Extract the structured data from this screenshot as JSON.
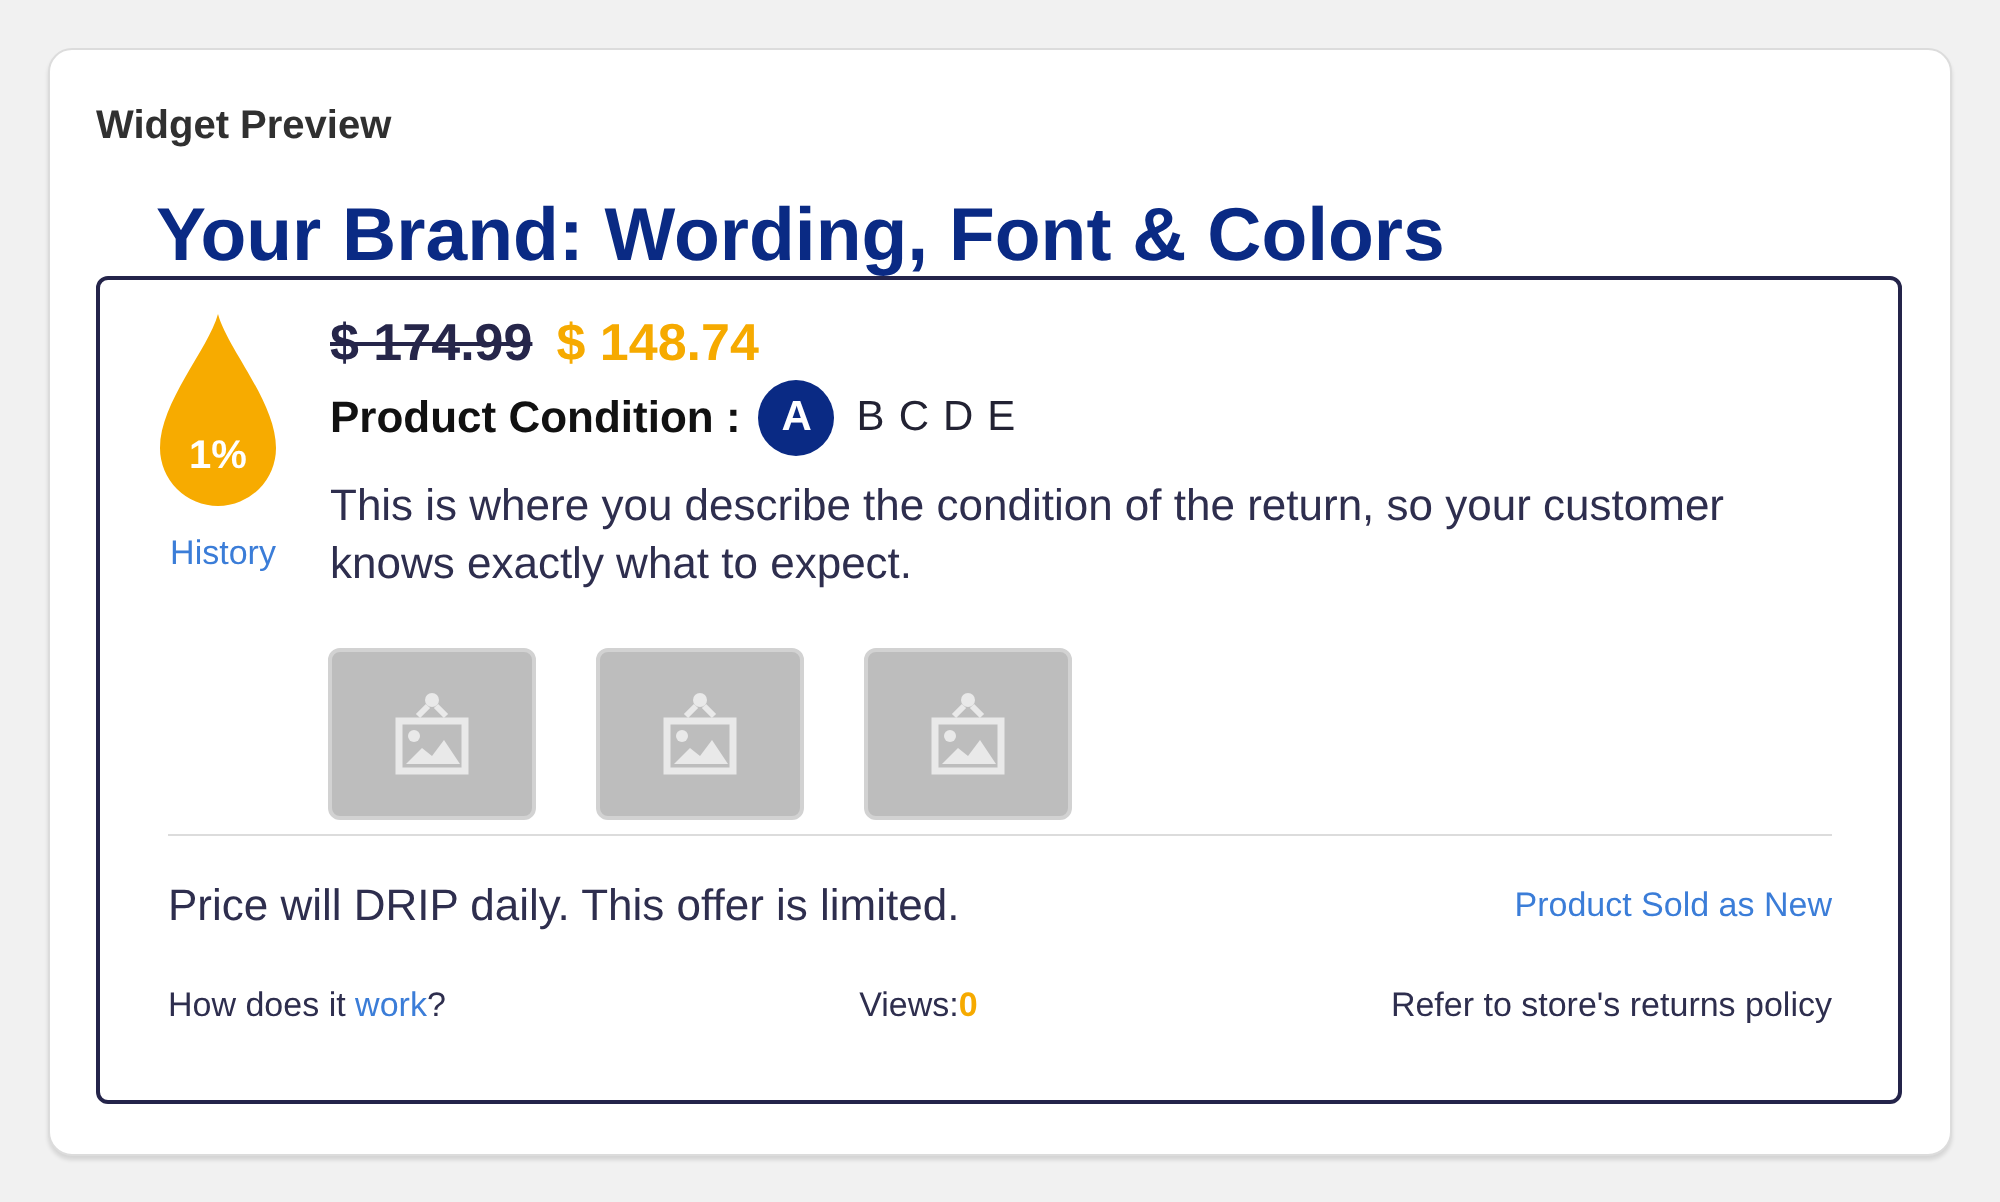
{
  "panel": {
    "title": "Widget Preview"
  },
  "headline": "Your Brand: Wording, Font & Colors",
  "widget": {
    "drop": {
      "discount": "1%"
    },
    "history_link": "History",
    "original_price": "$ 174.99",
    "sale_price": "$ 148.74",
    "condition": {
      "label": "Product Condition :",
      "grades": [
        {
          "label": "A",
          "selected": true
        },
        {
          "label": "B",
          "selected": false
        },
        {
          "label": "C",
          "selected": false
        },
        {
          "label": "D",
          "selected": false
        },
        {
          "label": "E",
          "selected": false
        }
      ]
    },
    "description": "This is where you describe the condition of the return, so your customer knows exactly what to expect.",
    "images": [
      {
        "kind": "placeholder"
      },
      {
        "kind": "placeholder"
      },
      {
        "kind": "placeholder"
      }
    ],
    "drip_notice": "Price will DRIP daily. This offer is limited.",
    "sold_as": "Product Sold as New",
    "footer": {
      "how_it_works": {
        "prefix": "How does it",
        "link": "work",
        "suffix": "?"
      },
      "views": {
        "label": "Views:",
        "count": "0"
      },
      "returns_policy": "Refer to store's returns policy"
    }
  }
}
